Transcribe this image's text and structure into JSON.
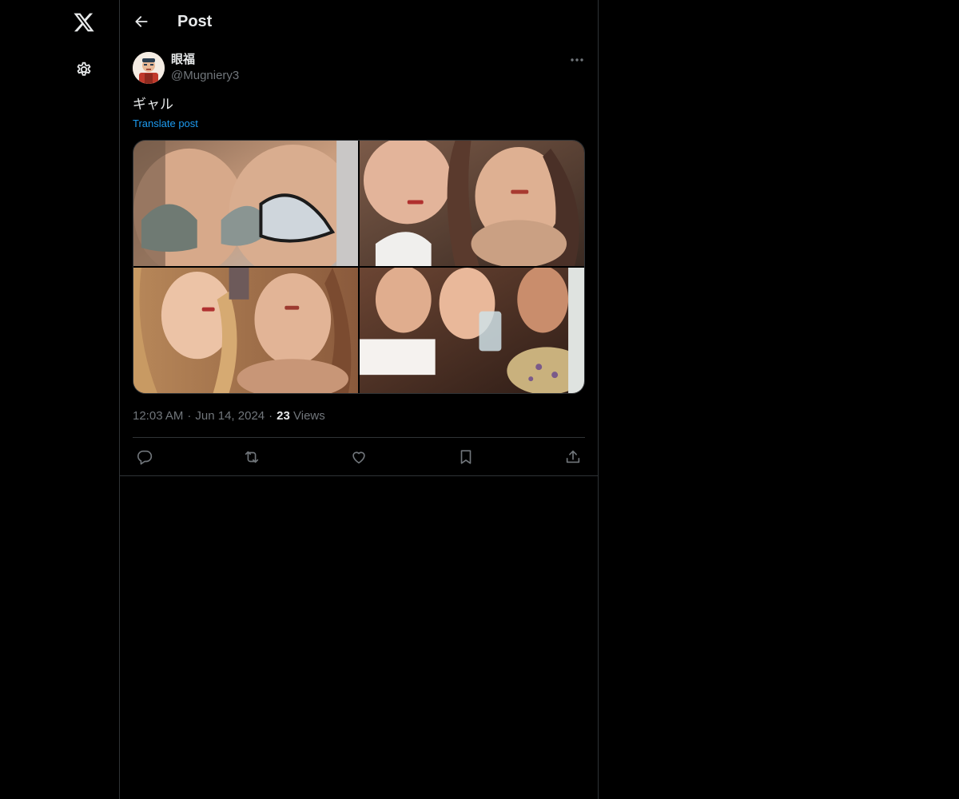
{
  "nav": {
    "logo_icon": "x-logo-icon",
    "settings_icon": "gear-icon"
  },
  "header": {
    "title": "Post",
    "back_icon": "arrow-left-icon"
  },
  "post": {
    "author": {
      "name": "眼福",
      "handle": "@Mugniery3"
    },
    "text": "ギャル",
    "translate_label": "Translate post",
    "time": "12:03 AM",
    "date": "Jun 14, 2024",
    "views_count": "23",
    "views_label": "Views",
    "media_count": 4
  },
  "actions": {
    "reply_icon": "reply-icon",
    "repost_icon": "repost-icon",
    "like_icon": "heart-icon",
    "bookmark_icon": "bookmark-icon",
    "share_icon": "share-icon"
  },
  "colors": {
    "background": "#000000",
    "text": "#e7e9ea",
    "muted": "#71767b",
    "accent": "#1d9bf0",
    "border": "#2f3336"
  }
}
